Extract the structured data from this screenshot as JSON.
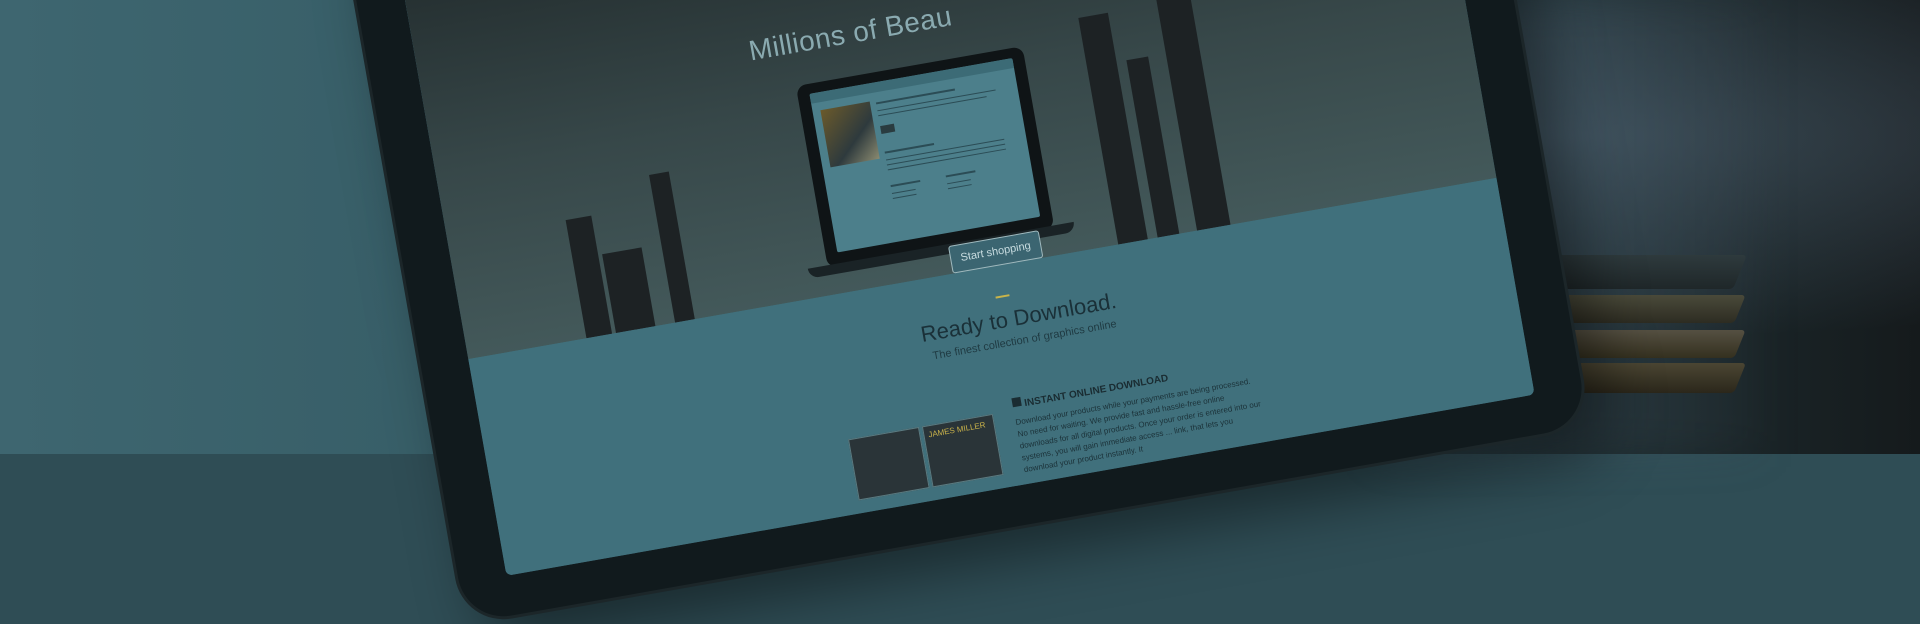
{
  "hero": {
    "title": "Millions of Beau"
  },
  "cta": {
    "label": "Start shopping"
  },
  "section": {
    "title": "Ready to Download.",
    "subtitle": "The finest collection of graphics online"
  },
  "feature": {
    "title": "INSTANT ONLINE DOWNLOAD",
    "text": "Download your products while your payments are being processed. No need for waiting. We provide fast and hassle-free online downloads for all digital products. Once your order is entered into our systems, you will gain immediate access ... link, that lets you download your product instantly. It"
  },
  "thumbnails": [
    {
      "label": ""
    },
    {
      "label": "JAMES MILLER"
    }
  ],
  "colors": {
    "overlay": "#40707c",
    "accent": "#c9b44a",
    "tablet_frame": "#111a1d"
  }
}
